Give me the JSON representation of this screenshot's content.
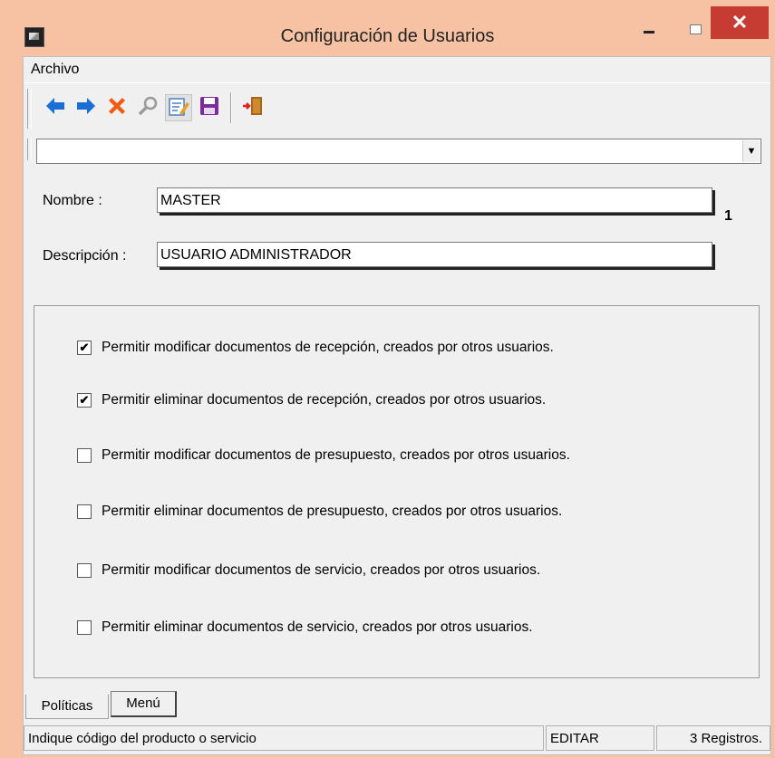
{
  "window": {
    "title": "Configuración de Usuarios",
    "close_glyph": "✕"
  },
  "menu": {
    "archivo": "Archivo"
  },
  "toolbar": {
    "buttons": [
      {
        "name": "back",
        "icon": "arrow-left-icon",
        "glyph": "🡐"
      },
      {
        "name": "forward",
        "icon": "arrow-right-icon",
        "glyph": "🡒"
      },
      {
        "name": "delete",
        "icon": "x-icon",
        "glyph": "✖"
      },
      {
        "name": "search",
        "icon": "magnifier-icon",
        "glyph": ""
      },
      {
        "name": "edit",
        "icon": "edit-icon",
        "glyph": ""
      },
      {
        "name": "save",
        "icon": "floppy-icon",
        "glyph": ""
      },
      {
        "name": "exit",
        "icon": "exit-door-icon",
        "glyph": ""
      }
    ]
  },
  "combo": {
    "value": "",
    "arrow": "▼"
  },
  "form": {
    "nombre_label": "Nombre :",
    "nombre_value": "MASTER",
    "id_number": "1",
    "descripcion_label": "Descripción :",
    "descripcion_value": "USUARIO ADMINISTRADOR"
  },
  "options": [
    {
      "label": "Permitir modificar documentos de recepción, creados por otros usuarios.",
      "checked": true
    },
    {
      "label": "Permitir eliminar documentos de recepción, creados por otros usuarios.",
      "checked": true
    },
    {
      "label": "Permitir modificar documentos de presupuesto, creados por otros usuarios.",
      "checked": false
    },
    {
      "label": "Permitir eliminar documentos de presupuesto, creados por otros usuarios.",
      "checked": false
    },
    {
      "label": "Permitir modificar documentos de servicio, creados por otros usuarios.",
      "checked": false
    },
    {
      "label": "Permitir eliminar documentos de servicio, creados por otros usuarios.",
      "checked": false
    }
  ],
  "tabs": {
    "politicas": "Políticas",
    "menu": "Menú"
  },
  "status": {
    "hint": "Indique código del producto o servicio",
    "mode": "EDITAR",
    "records": "3 Registros."
  },
  "colors": {
    "titlebar": "#f7c2a3",
    "close": "#c63b32",
    "arrow_blue": "#1a6fd6",
    "delete_red": "#f05a12",
    "save_purple": "#7b2c9c"
  }
}
